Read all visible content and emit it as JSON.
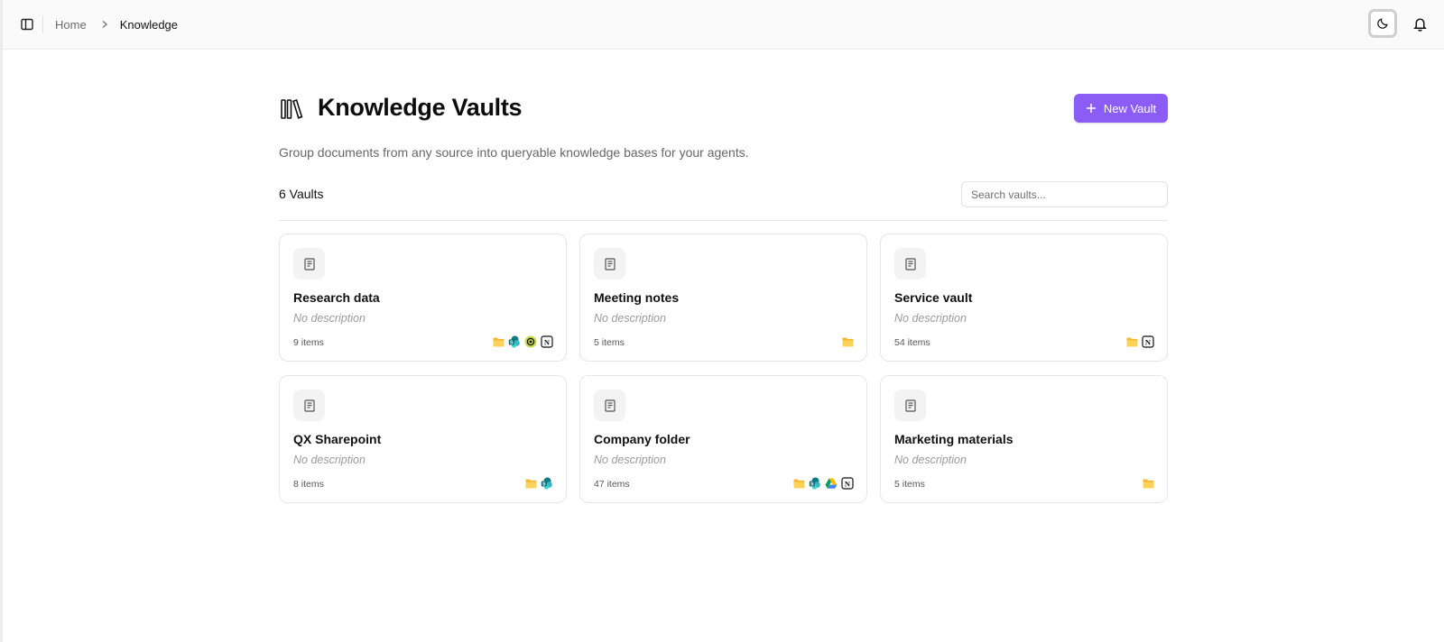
{
  "breadcrumb": {
    "home": "Home",
    "current": "Knowledge"
  },
  "header": {
    "title": "Knowledge Vaults",
    "subtitle": "Group documents from any source into queryable knowledge bases for your agents.",
    "new_vault_label": "New Vault"
  },
  "toolbar": {
    "count": "6 Vaults",
    "search_placeholder": "Search vaults..."
  },
  "colors": {
    "accent": "#8b5cf6",
    "folder": "#f5b82e"
  },
  "vaults": [
    {
      "title": "Research data",
      "description": "No description",
      "count": "9 items",
      "sources": [
        "folder-icon",
        "sharepoint-icon",
        "openai-icon",
        "notion-icon"
      ]
    },
    {
      "title": "Meeting notes",
      "description": "No description",
      "count": "5 items",
      "sources": [
        "folder-icon"
      ]
    },
    {
      "title": "Service vault",
      "description": "No description",
      "count": "54 items",
      "sources": [
        "folder-icon",
        "notion-icon"
      ]
    },
    {
      "title": "QX Sharepoint",
      "description": "No description",
      "count": "8 items",
      "sources": [
        "folder-icon",
        "sharepoint-icon"
      ]
    },
    {
      "title": "Company folder",
      "description": "No description",
      "count": "47 items",
      "sources": [
        "folder-icon",
        "sharepoint-icon",
        "google-drive-icon",
        "notion-icon"
      ]
    },
    {
      "title": "Marketing materials",
      "description": "No description",
      "count": "5 items",
      "sources": [
        "folder-icon"
      ]
    }
  ]
}
